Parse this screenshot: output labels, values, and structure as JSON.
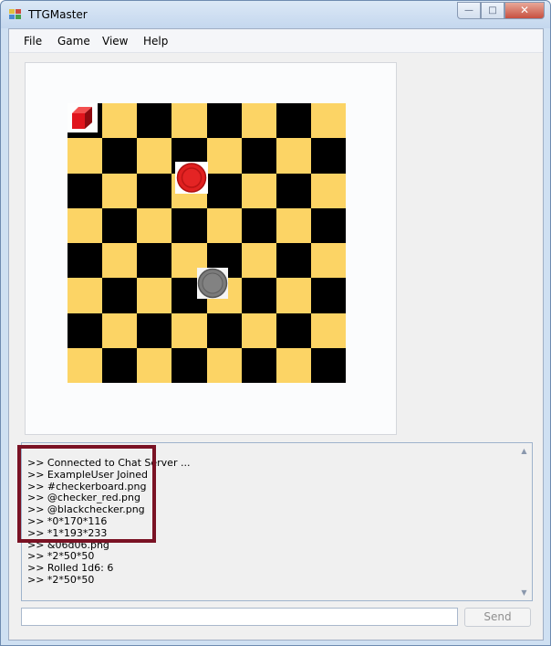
{
  "window": {
    "title": "TTGMaster",
    "minimize_symbol": "—",
    "maximize_symbol": "□",
    "close_symbol": "✕"
  },
  "menu": {
    "items": [
      "File",
      "Game",
      "View",
      "Help"
    ]
  },
  "board": {
    "rows": 8,
    "cols": 8,
    "light_color": "#fcd465",
    "dark_color": "#000000",
    "pieces": [
      "red-cube",
      "red-checker",
      "black-checker"
    ]
  },
  "chat": {
    "lines": [
      ">> Connected to Chat Server ...",
      ">> ExampleUser Joined",
      ">> #checkerboard.png",
      ">> @checker_red.png",
      ">> @blackchecker.png",
      ">> *0*170*116",
      ">> *1*193*233",
      ">> &06d06.png",
      ">> *2*50*50",
      ">> Rolled 1d6: 6",
      ">> *2*50*50"
    ],
    "highlight_color": "#7a1224",
    "scroll_up_symbol": "▲",
    "scroll_down_symbol": "▼"
  },
  "input": {
    "value": "",
    "send_label": "Send"
  }
}
